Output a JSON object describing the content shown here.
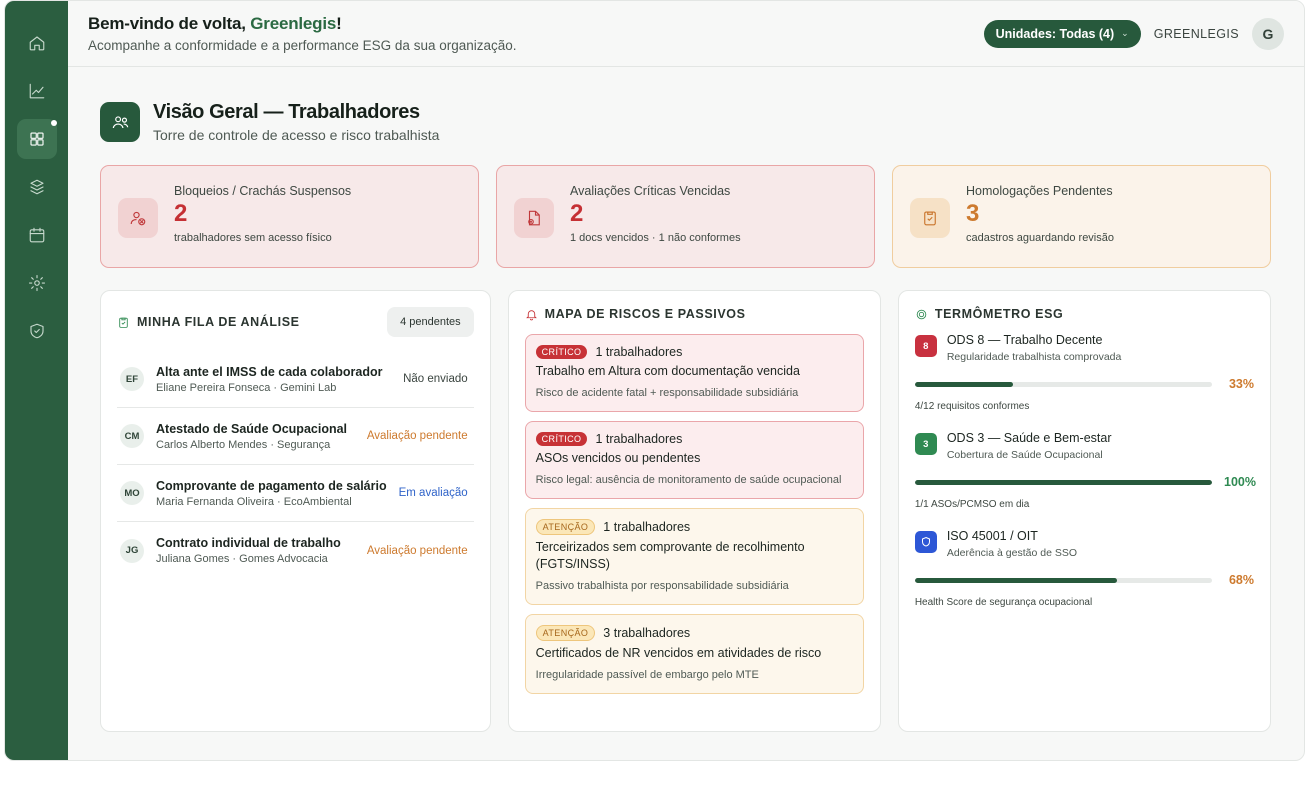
{
  "sidebar": {
    "items": [
      {
        "icon": "home-icon"
      },
      {
        "icon": "trend-chart-icon"
      },
      {
        "icon": "dashboard-icon",
        "active": true
      },
      {
        "icon": "layers-icon"
      },
      {
        "icon": "calendar-icon"
      },
      {
        "icon": "settings-icon"
      },
      {
        "icon": "shield-check-icon"
      }
    ]
  },
  "header": {
    "welcome_prefix": "Bem-vindo de volta, ",
    "org_name": "Greenlegis",
    "welcome_suffix": "!",
    "subtitle": "Acompanhe a conformidade e a performance ESG da sua organização.",
    "units_label": "Unidades: Todas (4)",
    "user_name": "GREENLEGIS",
    "user_initial": "G"
  },
  "page": {
    "title": "Visão Geral — Trabalhadores",
    "subtitle": "Torre de controle de acesso e risco trabalhista"
  },
  "kpis": [
    {
      "label": "Bloqueios / Crachás Suspensos",
      "value": "2",
      "desc": "trabalhadores sem acesso físico",
      "tone": "red"
    },
    {
      "label": "Avaliações Críticas Vencidas",
      "value": "2",
      "desc": "1 docs vencidos · 1 não conformes",
      "tone": "red"
    },
    {
      "label": "Homologações Pendentes",
      "value": "3",
      "desc": "cadastros aguardando revisão",
      "tone": "orange"
    }
  ],
  "queue": {
    "title": "MINHA FILA DE ANÁLISE",
    "pending_badge": "4 pendentes",
    "items": [
      {
        "initials": "EF",
        "title": "Alta ante el IMSS de cada colaborador",
        "sub": "Eliane Pereira Fonseca · Gemini Lab",
        "status": "Não enviado",
        "status_tone": "gray"
      },
      {
        "initials": "CM",
        "title": "Atestado de Saúde Ocupacional",
        "sub": "Carlos Alberto Mendes · Segurança",
        "status": "Avaliação pendente",
        "status_tone": "orange"
      },
      {
        "initials": "MO",
        "title": "Comprovante de pagamento de salário",
        "sub": "Maria Fernanda Oliveira · EcoAmbiental",
        "status": "Em avaliação",
        "status_tone": "blue"
      },
      {
        "initials": "JG",
        "title": "Contrato individual de trabalho",
        "sub": "Juliana Gomes · Gomes Advocacia",
        "status": "Avaliação pendente",
        "status_tone": "orange"
      }
    ]
  },
  "risks": {
    "title": "MAPA DE RISCOS E PASSIVOS",
    "items": [
      {
        "tag": "CRÍTICO",
        "tone": "crit",
        "count": "1 trabalhadores",
        "title": "Trabalho em Altura com documentação vencida",
        "sub": "Risco de acidente fatal + responsabilidade subsidiária"
      },
      {
        "tag": "CRÍTICO",
        "tone": "crit",
        "count": "1 trabalhadores",
        "title": "ASOs vencidos ou pendentes",
        "sub": "Risco legal: ausência de monitoramento de saúde ocupacional"
      },
      {
        "tag": "ATENÇÃO",
        "tone": "warn",
        "count": "1 trabalhadores",
        "title": "Terceirizados sem comprovante de recolhimento (FGTS/INSS)",
        "sub": "Passivo trabalhista por responsabilidade subsidiária"
      },
      {
        "tag": "ATENÇÃO",
        "tone": "warn",
        "count": "3 trabalhadores",
        "title": "Certificados de NR vencidos em atividades de risco",
        "sub": "Irregularidade passível de embargo pelo MTE"
      }
    ]
  },
  "esg": {
    "title": "TERMÔMETRO ESG",
    "items": [
      {
        "badge": "8",
        "badge_color": "#c8313f",
        "name": "ODS 8 — Trabalho Decente",
        "desc": "Regularidade trabalhista comprovada",
        "progress": 0.33,
        "pct": "33%",
        "pct_color": "#cd7a2e",
        "note": "4/12 requisitos conformes"
      },
      {
        "badge": "3",
        "badge_color": "#2f8a52",
        "name": "ODS 3 — Saúde e Bem-estar",
        "desc": "Cobertura de Saúde Ocupacional",
        "progress": 1.0,
        "pct": "100%",
        "pct_color": "#2f8a52",
        "note": "1/1 ASOs/PCMSO em dia"
      },
      {
        "badge": "",
        "badge_color": "#2d57d6",
        "name": "ISO 45001 / OIT",
        "desc": "Aderência à gestão de SSO",
        "progress": 0.68,
        "pct": "68%",
        "pct_color": "#cd7a2e",
        "note": "Health Score de segurança ocupacional"
      }
    ]
  }
}
